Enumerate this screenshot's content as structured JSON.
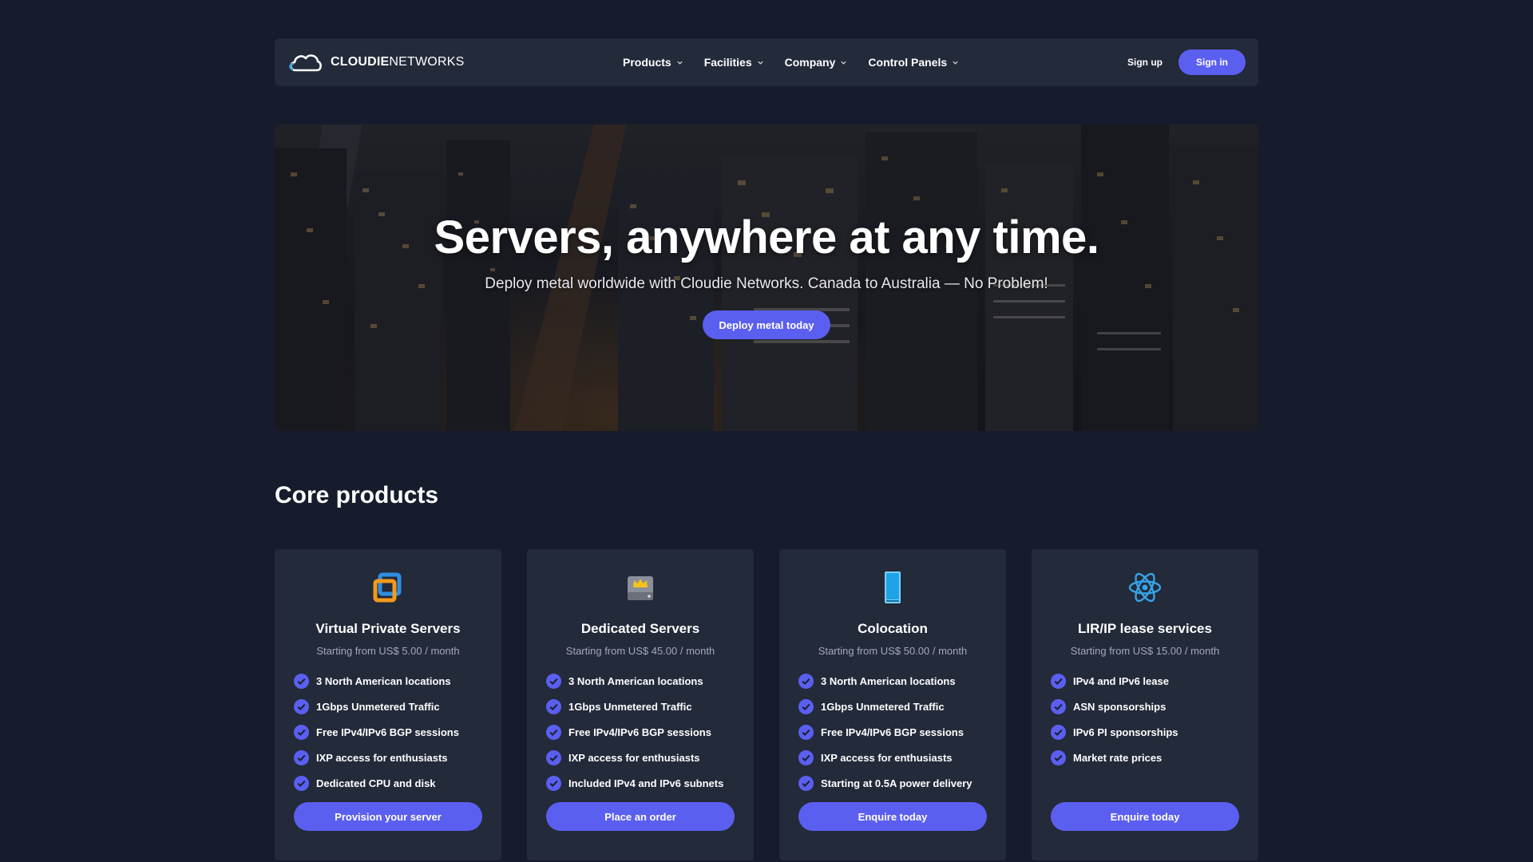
{
  "brand": {
    "name_bold": "CLOUDIE",
    "name_light": "NETWORKS",
    "logo_icon": "cloud-icon"
  },
  "nav": {
    "items": [
      {
        "label": "Products"
      },
      {
        "label": "Facilities"
      },
      {
        "label": "Company"
      },
      {
        "label": "Control Panels"
      }
    ],
    "signup_label": "Sign up",
    "signin_label": "Sign in"
  },
  "hero": {
    "title": "Servers, anywhere at any time.",
    "subtitle": "Deploy metal worldwide with Cloudie Networks. Canada to Australia — No Problem!",
    "cta_label": "Deploy metal today"
  },
  "core": {
    "title": "Core products",
    "cards": [
      {
        "icon": "vps-windows-icon",
        "title": "Virtual Private Servers",
        "price": "Starting from US$ 5.00 / month",
        "features": [
          "3 North American locations",
          "1Gbps Unmetered Traffic",
          "Free IPv4/IPv6 BGP sessions",
          "IXP access for enthusiasts",
          "Dedicated CPU and disk"
        ],
        "button": "Provision your server"
      },
      {
        "icon": "server-crown-icon",
        "title": "Dedicated Servers",
        "price": "Starting from US$ 45.00 / month",
        "features": [
          "3 North American locations",
          "1Gbps Unmetered Traffic",
          "Free IPv4/IPv6 BGP sessions",
          "IXP access for enthusiasts",
          "Included IPv4 and IPv6 subnets"
        ],
        "button": "Place an order"
      },
      {
        "icon": "rack-icon",
        "title": "Colocation",
        "price": "Starting from US$ 50.00 / month",
        "features": [
          "3 North American locations",
          "1Gbps Unmetered Traffic",
          "Free IPv4/IPv6 BGP sessions",
          "IXP access for enthusiasts",
          "Starting at 0.5A power delivery"
        ],
        "button": "Enquire today"
      },
      {
        "icon": "atom-icon",
        "title": "LIR/IP lease services",
        "price": "Starting from US$ 15.00 / month",
        "features": [
          "IPv4 and IPv6 lease",
          "ASN sponsorships",
          "IPv6 PI sponsorships",
          "Market rate prices"
        ],
        "button": "Enquire today"
      }
    ]
  },
  "colors": {
    "background": "#161c2b",
    "panel": "#232a3a",
    "accent": "#5b5ff0",
    "muted_text": "#a3a9b8"
  }
}
